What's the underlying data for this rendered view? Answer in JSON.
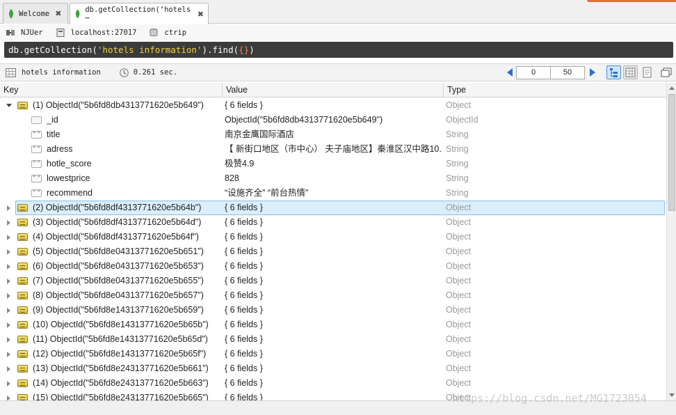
{
  "tabs": [
    {
      "label": "Welcome",
      "close": "✖"
    },
    {
      "label": "db.getCollection(‘hotels ⋯",
      "close": "✖"
    }
  ],
  "connection": {
    "user": "NJUer",
    "host": "localhost:27017",
    "database": "ctrip"
  },
  "query": {
    "prefix": "db.getCollection(",
    "arg": "'hotels information'",
    "mid": ").find(",
    "inner": "{}",
    "suffix": ")"
  },
  "result_toolbar": {
    "collection": "hotels information",
    "time": "0.261 sec.",
    "skip": "0",
    "limit": "50"
  },
  "columns": {
    "key": "Key",
    "value": "Value",
    "type": "Type"
  },
  "expanded_doc": {
    "key": "(1) ObjectId(\"5b6fd8db4313771620e5b649\")",
    "value": "{ 6 fields }",
    "type": "Object",
    "fields": [
      {
        "key": "_id",
        "value": "ObjectId(\"5b6fd8db4313771620e5b649\")",
        "type": "ObjectId",
        "icon": "field-icon"
      },
      {
        "key": "title",
        "value": "南京金鹰国际酒店",
        "type": "String",
        "icon": "string-icon"
      },
      {
        "key": "adress",
        "value": "【 新街口地区（市中心） 夫子庙地区】秦淮区汉中路10...",
        "type": "String",
        "icon": "string-icon"
      },
      {
        "key": "hotle_score",
        "value": "极赞4.9",
        "type": "String",
        "icon": "string-icon"
      },
      {
        "key": "lowestprice",
        "value": "828",
        "type": "String",
        "icon": "string-icon"
      },
      {
        "key": "recommend",
        "value": " “设施齐全”  “前台热情”",
        "type": "String",
        "icon": "string-icon"
      }
    ]
  },
  "collapsed_docs": [
    {
      "key": "(2) ObjectId(\"5b6fd8df4313771620e5b64b\")",
      "value": "{ 6 fields }",
      "type": "Object",
      "selected": true
    },
    {
      "key": "(3) ObjectId(\"5b6fd8df4313771620e5b64d\")",
      "value": "{ 6 fields }",
      "type": "Object"
    },
    {
      "key": "(4) ObjectId(\"5b6fd8df4313771620e5b64f\")",
      "value": "{ 6 fields }",
      "type": "Object"
    },
    {
      "key": "(5) ObjectId(\"5b6fd8e04313771620e5b651\")",
      "value": "{ 6 fields }",
      "type": "Object"
    },
    {
      "key": "(6) ObjectId(\"5b6fd8e04313771620e5b653\")",
      "value": "{ 6 fields }",
      "type": "Object"
    },
    {
      "key": "(7) ObjectId(\"5b6fd8e04313771620e5b655\")",
      "value": "{ 6 fields }",
      "type": "Object"
    },
    {
      "key": "(8) ObjectId(\"5b6fd8e04313771620e5b657\")",
      "value": "{ 6 fields }",
      "type": "Object"
    },
    {
      "key": "(9) ObjectId(\"5b6fd8e14313771620e5b659\")",
      "value": "{ 6 fields }",
      "type": "Object"
    },
    {
      "key": "(10) ObjectId(\"5b6fd8e14313771620e5b65b\")",
      "value": "{ 6 fields }",
      "type": "Object"
    },
    {
      "key": "(11) ObjectId(\"5b6fd8e14313771620e5b65d\")",
      "value": "{ 6 fields }",
      "type": "Object"
    },
    {
      "key": "(12) ObjectId(\"5b6fd8e14313771620e5b65f\")",
      "value": "{ 6 fields }",
      "type": "Object"
    },
    {
      "key": "(13) ObjectId(\"5b6fd8e24313771620e5b661\")",
      "value": "{ 6 fields }",
      "type": "Object"
    },
    {
      "key": "(14) ObjectId(\"5b6fd8e24313771620e5b663\")",
      "value": "{ 6 fields }",
      "type": "Object"
    },
    {
      "key": "(15) ObjectId(\"5b6fd8e24313771620e5b665\")",
      "value": "{ 6 fields }",
      "type": "Object"
    }
  ],
  "watermark": "https://blog.csdn.net/MG1723054",
  "colors": {
    "accent": "#2a6fd6",
    "query_bg": "#3b3b3b",
    "query_string": "#f4d23c",
    "query_paren": "#f08a4b",
    "selection": "#dbeefb"
  }
}
